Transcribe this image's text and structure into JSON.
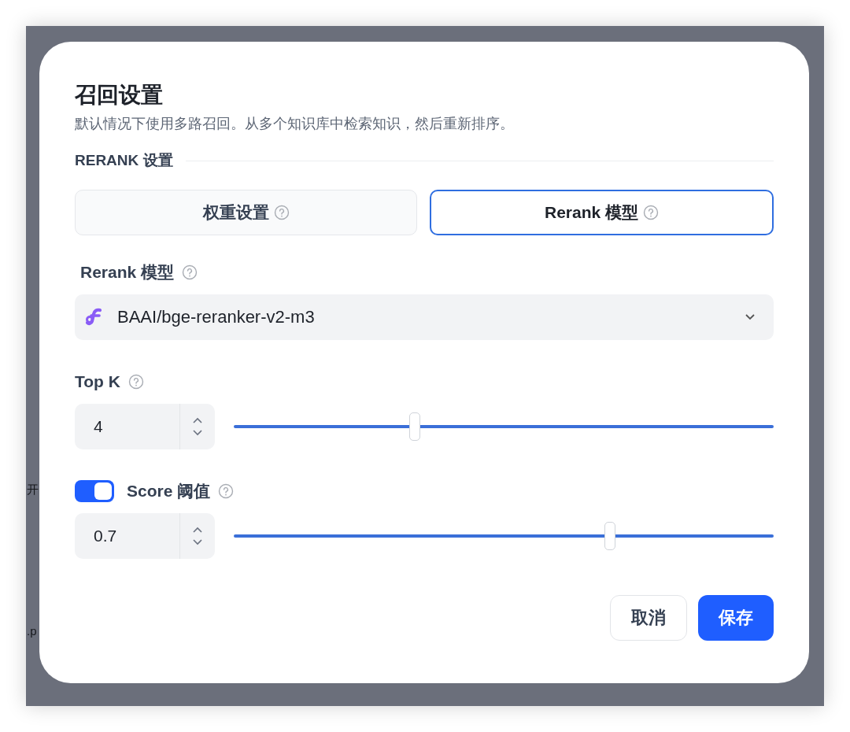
{
  "background": {
    "texts": [
      "开",
      ".p"
    ]
  },
  "dialog": {
    "title": "召回设置",
    "description": "默认情况下使用多路召回。从多个知识库中检索知识，然后重新排序。",
    "section_label": "RERANK 设置",
    "tabs": [
      {
        "label": "权重设置",
        "selected": false
      },
      {
        "label": "Rerank 模型",
        "selected": true
      }
    ],
    "model_field": {
      "label": "Rerank 模型",
      "value": "BAAI/bge-reranker-v2-m3"
    },
    "settings": [
      {
        "kind": "plain",
        "label": "Top K",
        "value": "4",
        "level": 0.335
      },
      {
        "kind": "toggle",
        "label": "Score 阈值",
        "on": true,
        "value": "0.7",
        "level": 0.697
      }
    ],
    "buttons": [
      {
        "label": "取消",
        "primary": false
      },
      {
        "label": "保存",
        "primary": true
      }
    ]
  }
}
